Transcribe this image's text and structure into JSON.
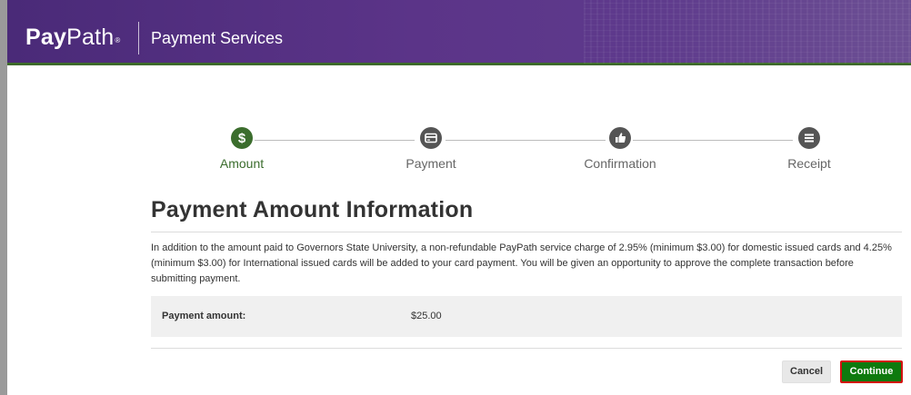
{
  "header": {
    "logo_bold": "Pay",
    "logo_light": "Path",
    "logo_mark": "®",
    "title": "Payment Services",
    "brand_color": "#5b3488"
  },
  "steps": [
    {
      "label": "Amount",
      "icon": "dollar-icon",
      "active": true
    },
    {
      "label": "Payment",
      "icon": "card-icon",
      "active": false
    },
    {
      "label": "Confirmation",
      "icon": "thumbs-up-icon",
      "active": false
    },
    {
      "label": "Receipt",
      "icon": "list-icon",
      "active": false
    }
  ],
  "main": {
    "title": "Payment Amount Information",
    "info_text": "In addition to the amount paid to Governors State University, a non-refundable PayPath service charge of 2.95% (minimum $3.00) for domestic issued cards and 4.25% (minimum $3.00) for International issued cards will be added to your card payment. You will be given an opportunity to approve the complete transaction before submitting payment.",
    "amount_label": "Payment amount:",
    "amount_value": "$25.00"
  },
  "buttons": {
    "cancel": "Cancel",
    "continue": "Continue"
  },
  "colors": {
    "active_step": "#3b6d2d",
    "inactive_step": "#555555",
    "continue_bg": "#0e7a0e",
    "continue_border": "#d31212"
  }
}
